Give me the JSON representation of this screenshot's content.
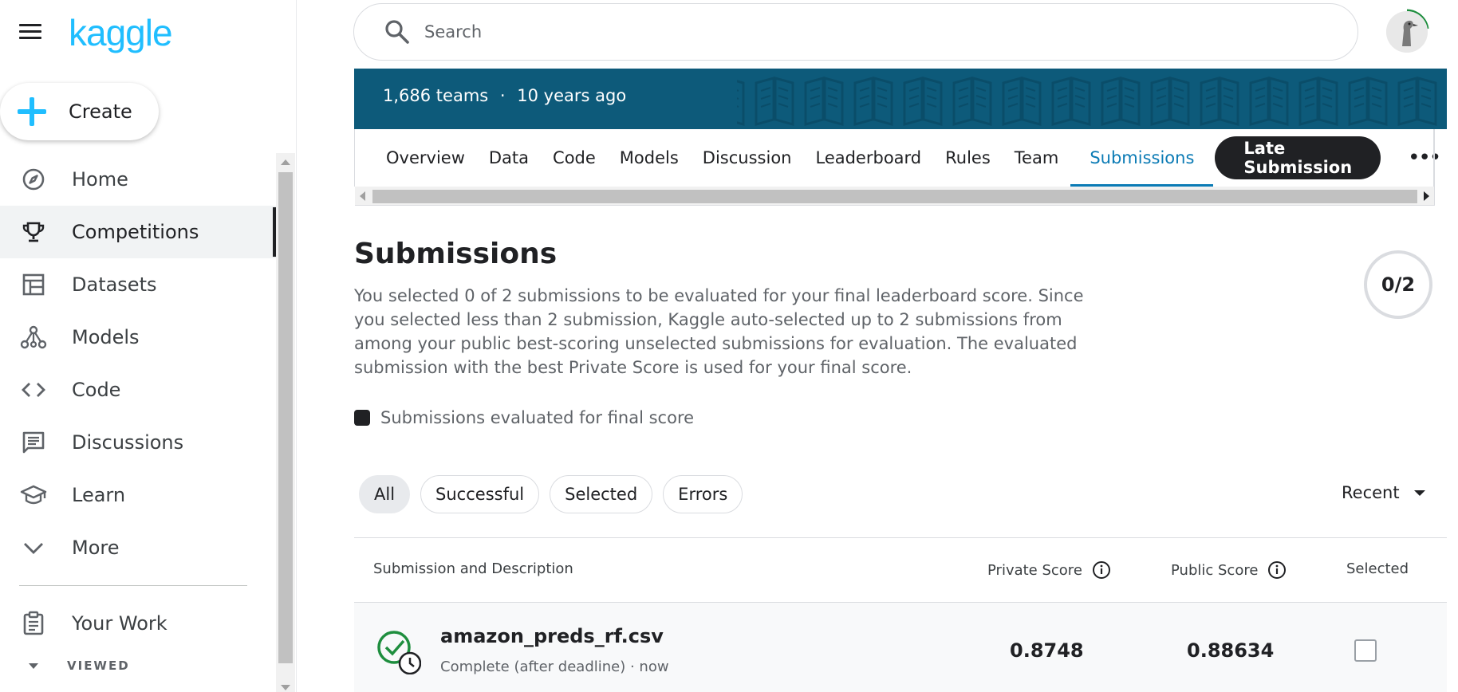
{
  "sidebar": {
    "logo": "kaggle",
    "create_label": "Create",
    "items": [
      {
        "label": "Home",
        "icon": "compass-icon"
      },
      {
        "label": "Competitions",
        "icon": "trophy-icon"
      },
      {
        "label": "Datasets",
        "icon": "table-icon"
      },
      {
        "label": "Models",
        "icon": "models-icon"
      },
      {
        "label": "Code",
        "icon": "code-icon"
      },
      {
        "label": "Discussions",
        "icon": "chat-icon"
      },
      {
        "label": "Learn",
        "icon": "graduation-cap-icon"
      },
      {
        "label": "More",
        "icon": "chevron-down-icon"
      }
    ],
    "your_work": "Your Work",
    "viewed": "VIEWED"
  },
  "search": {
    "placeholder": "Search"
  },
  "banner": {
    "teams": "1,686 teams",
    "separator": "·",
    "age": "10 years ago"
  },
  "tabs": [
    "Overview",
    "Data",
    "Code",
    "Models",
    "Discussion",
    "Leaderboard",
    "Rules",
    "Team",
    "Submissions"
  ],
  "late_submission": "Late Submission",
  "main": {
    "title": "Submissions",
    "description": "You selected 0 of 2 submissions to be evaluated for your final leaderboard score. Since you selected less than 2 submission, Kaggle auto-selected up to 2 submissions from among your public best-scoring unselected submissions for evaluation. The evaluated submission with the best Private Score is used for your final score.",
    "counter": "0/2",
    "legend": "Submissions evaluated for final score"
  },
  "filters": [
    "All",
    "Successful",
    "Selected",
    "Errors"
  ],
  "sort": "Recent",
  "table": {
    "headers": {
      "submission": "Submission and Description",
      "private": "Private Score",
      "public": "Public Score",
      "selected": "Selected"
    },
    "rows": [
      {
        "file": "amazon_preds_rf.csv",
        "status": "Complete (after deadline) · now",
        "private_score": "0.8748",
        "public_score": "0.88634"
      }
    ]
  },
  "colors": {
    "brand": "#20beff",
    "banner": "#0d5a7a",
    "active_tab": "#0b7bb5",
    "success": "#1e8e3e"
  }
}
